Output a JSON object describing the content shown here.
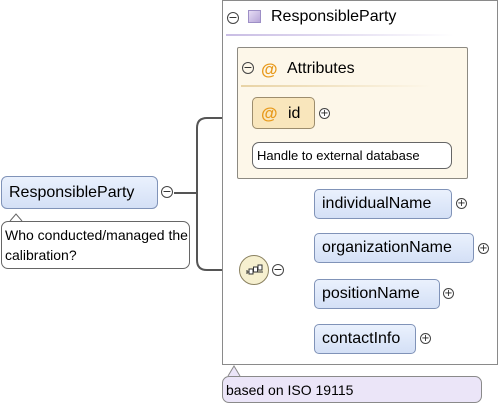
{
  "type_box": {
    "title": "ResponsibleParty",
    "attributes_title": "Attributes",
    "attribute": {
      "name": "id",
      "doc": "Handle to external database"
    }
  },
  "element": {
    "name": "ResponsibleParty",
    "doc": "Who conducted/managed the calibration?"
  },
  "children": [
    {
      "name": "individualName"
    },
    {
      "name": "organizationName"
    },
    {
      "name": "positionName"
    },
    {
      "name": "contactInfo"
    }
  ],
  "footer_doc": "based on ISO 19115",
  "icons": {
    "collapse": "collapse-minus-icon",
    "expand": "expand-plus-icon",
    "type": "complex-type-icon",
    "attribute": "attribute-at-icon",
    "compositor": "sequence-compositor-icon"
  },
  "colors": {
    "element_fill": "#dce6f8",
    "attribute_fill": "#f9e6bc",
    "attributes_group_fill": "#fdf7e9",
    "type_icon": "#b7a6d8",
    "compositor_fill": "#f6f0d0",
    "footer_fill": "#ebe5f8"
  }
}
